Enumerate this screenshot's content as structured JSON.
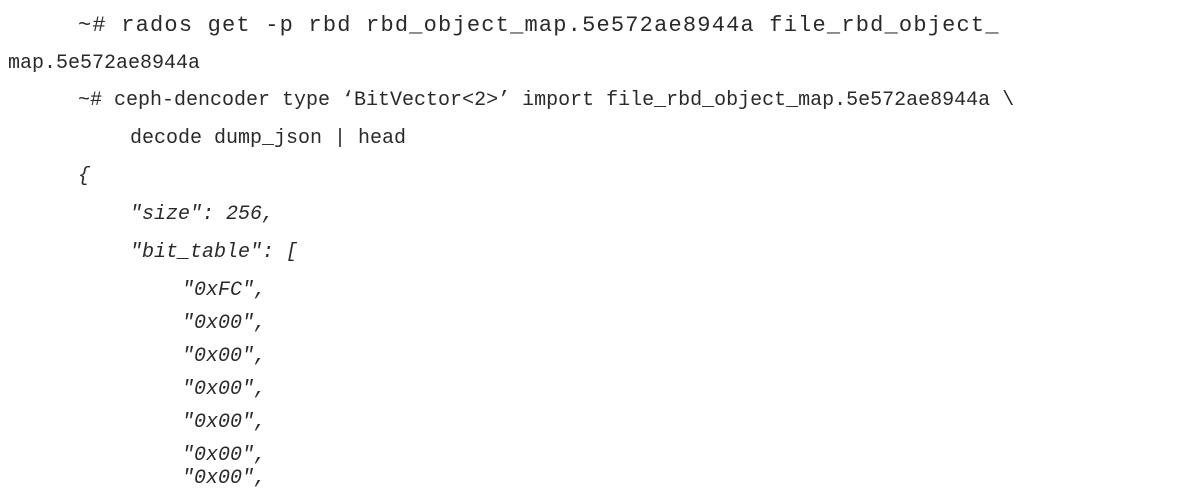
{
  "code_listing": {
    "lines": [
      "~# rados get -p rbd rbd_object_map.5e572ae8944a file_rbd_object_",
      "map.5e572ae8944a",
      "~# ceph-dencoder type ‘BitVector<2>’ import file_rbd_object_map.5e572ae8944a \\",
      "decode dump_json | head",
      "{",
      "\"size\": 256,",
      "\"bit_table\": [",
      "\"0xFC\",",
      "\"0x00\",",
      "\"0x00\",",
      "\"0x00\",",
      "\"0x00\",",
      "\"0x00\",",
      "\"0x00\","
    ]
  }
}
